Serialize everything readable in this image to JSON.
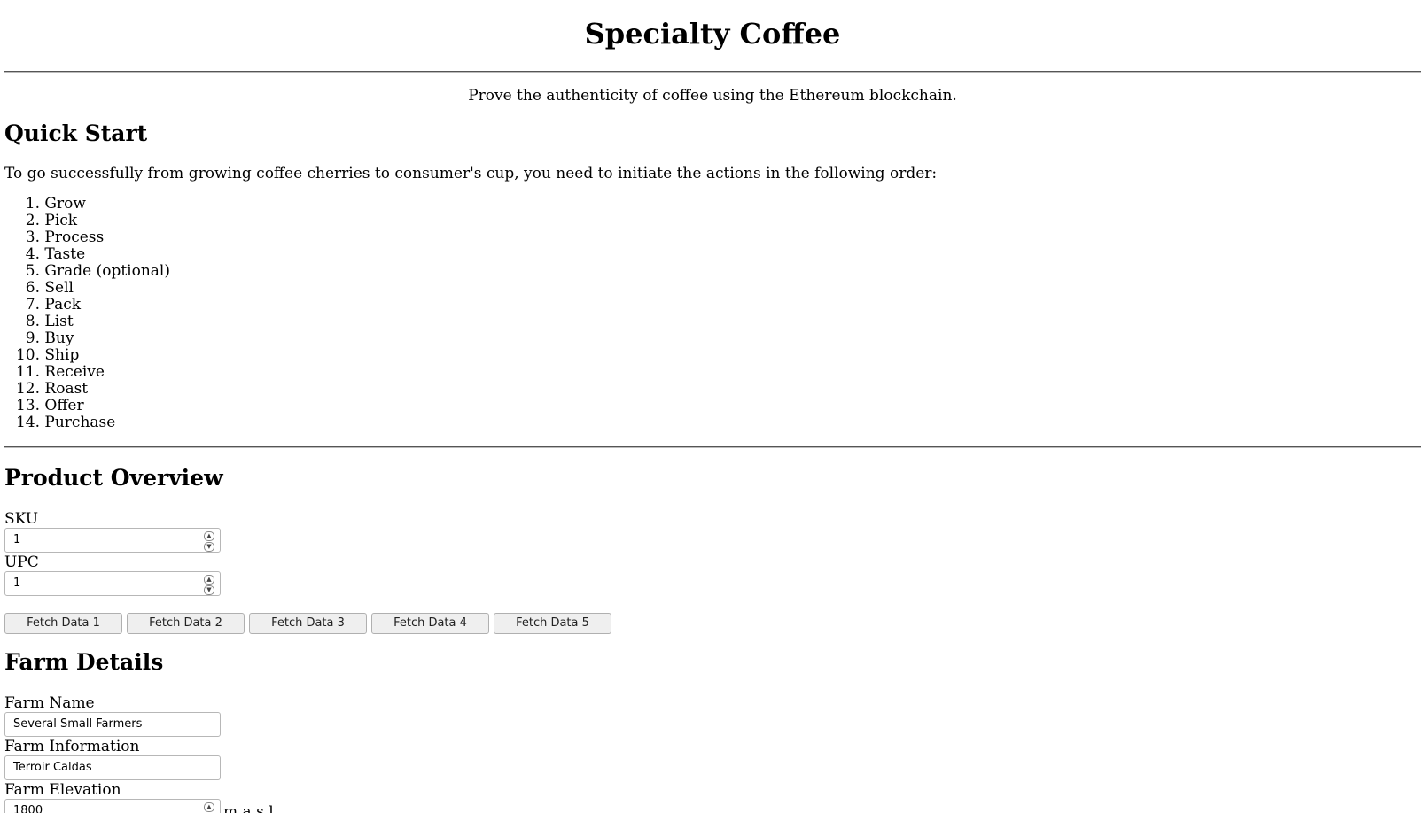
{
  "header": {
    "title": "Specialty Coffee",
    "tagline": "Prove the authenticity of coffee using the Ethereum blockchain."
  },
  "quick_start": {
    "heading": "Quick Start",
    "intro": "To go successfully from growing coffee cherries to consumer's cup, you need to initiate the actions in the following order:",
    "steps": [
      {
        "num": "1.",
        "label": "Grow"
      },
      {
        "num": "2.",
        "label": "Pick"
      },
      {
        "num": "3.",
        "label": "Process"
      },
      {
        "num": "4.",
        "label": "Taste"
      },
      {
        "num": "5.",
        "label": "Grade (optional)"
      },
      {
        "num": "6.",
        "label": "Sell"
      },
      {
        "num": "7.",
        "label": "Pack"
      },
      {
        "num": "8.",
        "label": "List"
      },
      {
        "num": "9.",
        "label": "Buy"
      },
      {
        "num": "10.",
        "label": "Ship"
      },
      {
        "num": "11.",
        "label": "Receive"
      },
      {
        "num": "12.",
        "label": "Roast"
      },
      {
        "num": "13.",
        "label": "Offer"
      },
      {
        "num": "14.",
        "label": "Purchase"
      }
    ]
  },
  "product_overview": {
    "heading": "Product Overview",
    "sku_label": "SKU",
    "sku_value": "1",
    "upc_label": "UPC",
    "upc_value": "1",
    "buttons": [
      "Fetch Data 1",
      "Fetch Data 2",
      "Fetch Data 3",
      "Fetch Data 4",
      "Fetch Data 5"
    ]
  },
  "farm_details": {
    "heading": "Farm Details",
    "name_label": "Farm Name",
    "name_value": "Several Small Farmers",
    "info_label": "Farm Information",
    "info_value": "Terroir Caldas",
    "elevation_label": "Farm Elevation",
    "elevation_value": "1800",
    "elevation_unit": "m.a.s.l."
  }
}
